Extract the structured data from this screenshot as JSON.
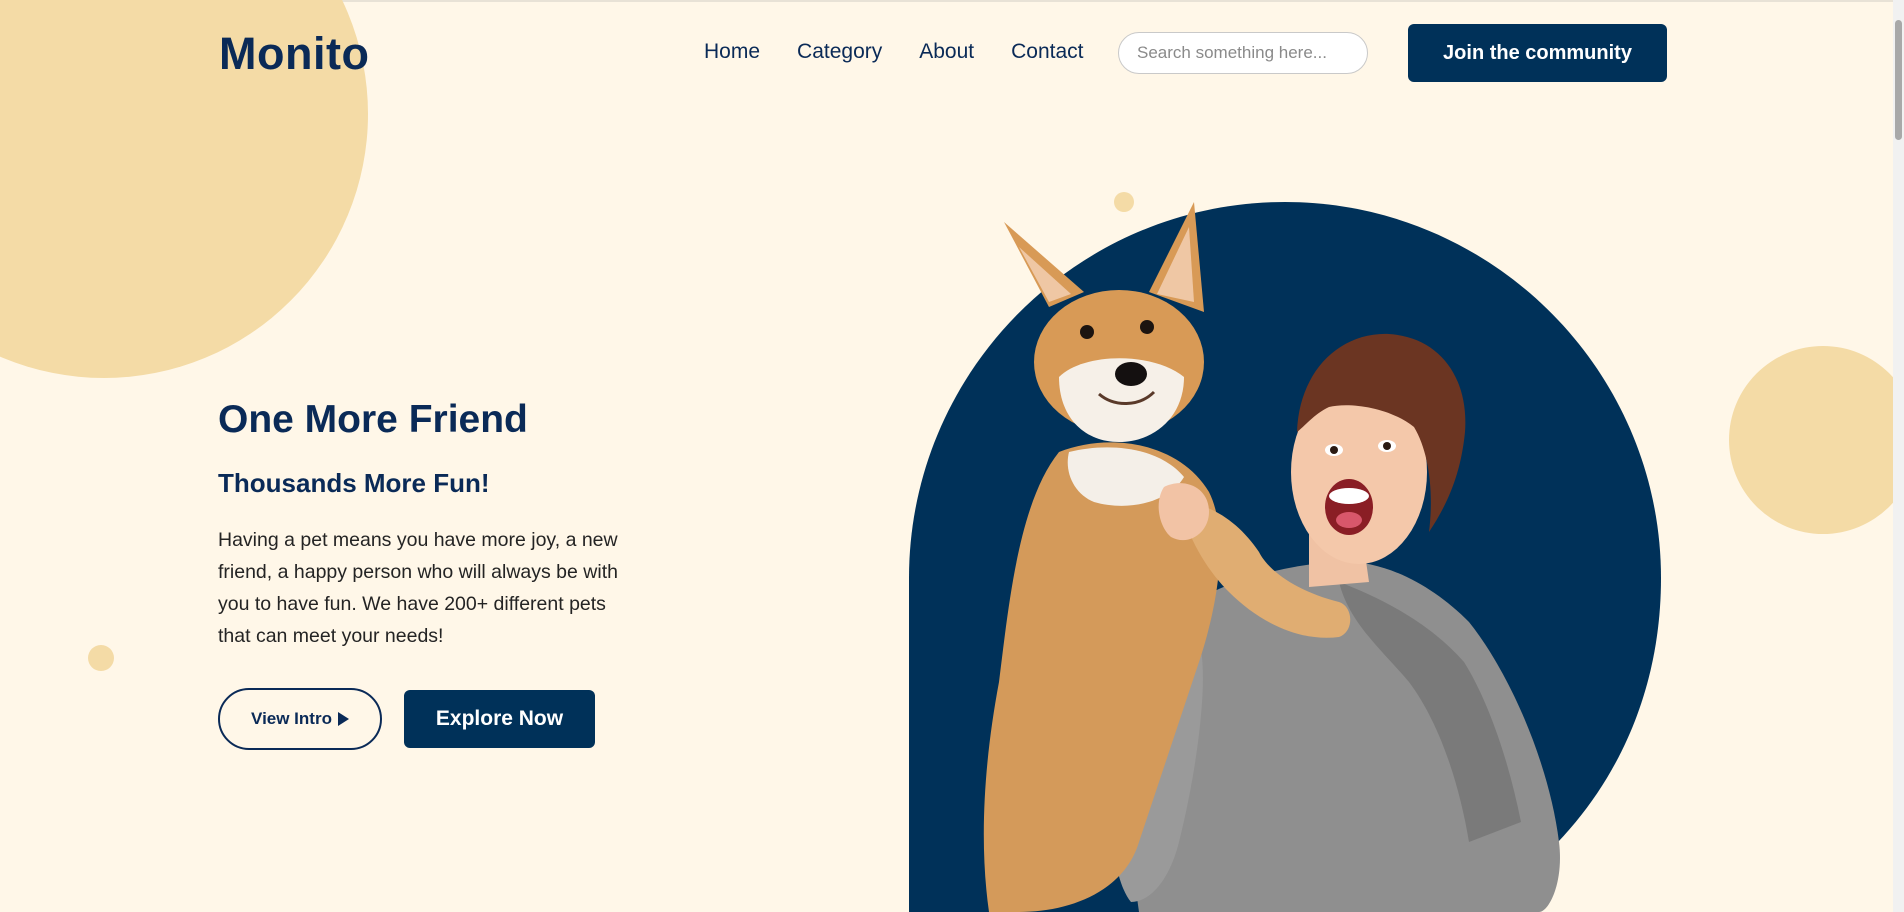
{
  "brand": {
    "logo": "Monito"
  },
  "nav": {
    "items": [
      "Home",
      "Category",
      "About",
      "Contact"
    ]
  },
  "search": {
    "placeholder": "Search something here...",
    "value": ""
  },
  "header": {
    "cta_label": "Join the community"
  },
  "hero": {
    "title": "One More Friend",
    "subtitle": "Thousands More Fun!",
    "body": "Having a pet means you have more joy, a new friend, a happy person who will always be with you to have fun. We have 200+ different pets that can meet your needs!",
    "intro_label": "View Intro",
    "explore_label": "Explore Now",
    "image_icon": "hero-photo-woman-with-corgi"
  },
  "colors": {
    "background": "#fff7e8",
    "primary": "#003159",
    "accent": "#f4dba6",
    "text": "#0a2a57"
  }
}
